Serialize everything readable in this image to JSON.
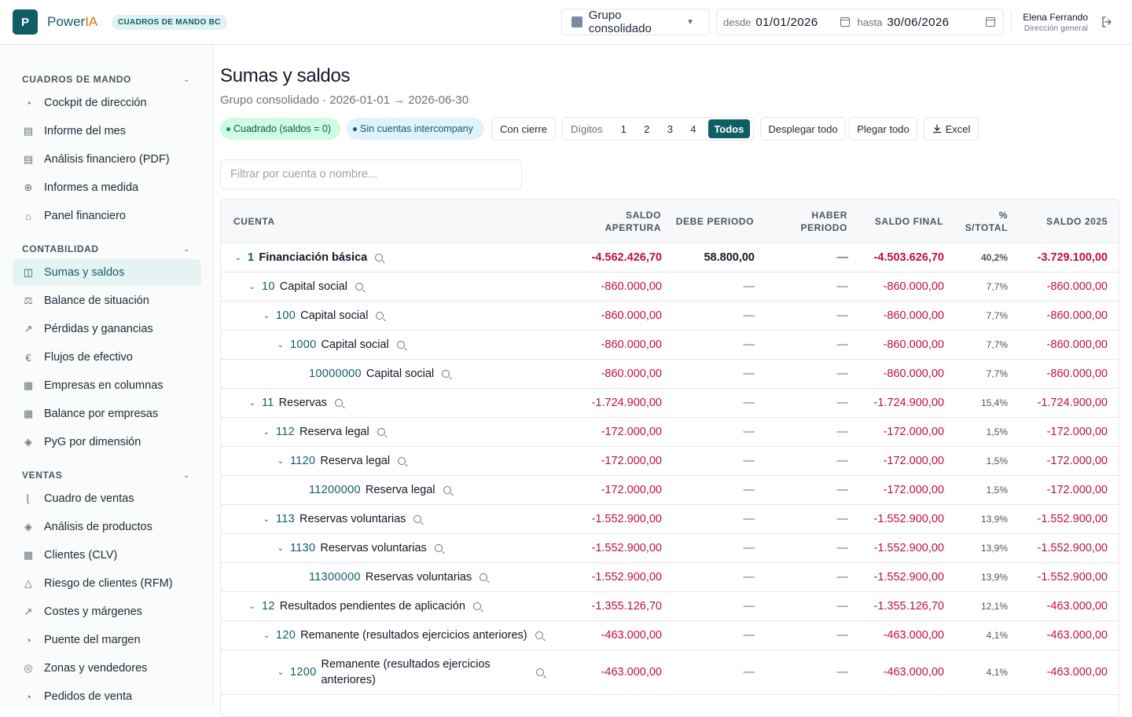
{
  "header": {
    "logo_letter": "P",
    "brand_main": "Power",
    "brand_accent": "IA",
    "module": "CUADROS DE MANDO BC",
    "group": "Grupo consolidado",
    "date_from_label": "desde",
    "date_from": "01/01/2026",
    "date_to_label": "hasta",
    "date_to": "30/06/2026",
    "user_name": "Elena Ferrando",
    "user_role": "Dirección general"
  },
  "sidebar": {
    "sections": [
      {
        "title": "CUADROS DE MANDO",
        "items": [
          {
            "label": "Cockpit de dirección",
            "icon": "gauge-icon"
          },
          {
            "label": "Informe del mes",
            "icon": "document-icon"
          },
          {
            "label": "Análisis financiero (PDF)",
            "icon": "document-icon"
          },
          {
            "label": "Informes a medida",
            "icon": "plus-circle-icon"
          },
          {
            "label": "Panel financiero",
            "icon": "home-icon"
          }
        ]
      },
      {
        "title": "CONTABILIDAD",
        "items": [
          {
            "label": "Sumas y saldos",
            "icon": "book-icon",
            "active": true
          },
          {
            "label": "Balance de situación",
            "icon": "scale-icon"
          },
          {
            "label": "Pérdidas y ganancias",
            "icon": "trend-icon"
          },
          {
            "label": "Flujos de efectivo",
            "icon": "euro-icon"
          },
          {
            "label": "Empresas en columnas",
            "icon": "building-icon"
          },
          {
            "label": "Balance por empresas",
            "icon": "building-icon"
          },
          {
            "label": "PyG por dimensión",
            "icon": "layers-icon"
          }
        ]
      },
      {
        "title": "VENTAS",
        "items": [
          {
            "label": "Cuadro de ventas",
            "icon": "chart-icon"
          },
          {
            "label": "Análisis de productos",
            "icon": "layers-icon"
          },
          {
            "label": "Clientes (CLV)",
            "icon": "building-icon"
          },
          {
            "label": "Riesgo de clientes (RFM)",
            "icon": "bell-icon"
          },
          {
            "label": "Costes y márgenes",
            "icon": "trend-icon"
          },
          {
            "label": "Puente del margen",
            "icon": "gauge-icon"
          },
          {
            "label": "Zonas y vendedores",
            "icon": "target-icon"
          },
          {
            "label": "Pedidos de venta",
            "icon": "gauge-icon"
          }
        ]
      }
    ]
  },
  "main": {
    "title": "Sumas y saldos",
    "subtitle": "Grupo consolidado · 2026-01-01 → 2026-06-30",
    "chip_balanced": "Cuadrado (saldos = 0)",
    "chip_intercompany": "Sin cuentas intercompany",
    "btn_closing": "Con cierre",
    "digits_label": "Dígitos",
    "digits": [
      "1",
      "2",
      "3",
      "4"
    ],
    "digits_active": "Todos",
    "btn_expand": "Desplegar todo",
    "btn_collapse": "Plegar todo",
    "btn_excel": "Excel",
    "filter_placeholder": "Filtrar por cuenta o nombre..."
  },
  "table": {
    "headers": {
      "account": "CUENTA",
      "opening_1": "SALDO",
      "opening_2": "APERTURA",
      "debit": "DEBE PERIODO",
      "credit_1": "HABER",
      "credit_2": "PERIODO",
      "final": "SALDO FINAL",
      "pct_1": "%",
      "pct_2": "S/TOTAL",
      "prev": "SALDO 2025"
    },
    "rows": [
      {
        "level": 0,
        "code": "1",
        "name": "Financiación básica",
        "expand": true,
        "opening": "-4.562.426,70",
        "debit": "58.800,00",
        "credit": "—",
        "final": "-4.503.626,70",
        "pct": "40,2%",
        "prev": "-3.729.100,00"
      },
      {
        "level": 1,
        "code": "10",
        "name": "Capital social",
        "expand": true,
        "opening": "-860.000,00",
        "debit": "—",
        "credit": "—",
        "final": "-860.000,00",
        "pct": "7,7%",
        "prev": "-860.000,00"
      },
      {
        "level": 2,
        "code": "100",
        "name": "Capital social",
        "expand": true,
        "opening": "-860.000,00",
        "debit": "—",
        "credit": "—",
        "final": "-860.000,00",
        "pct": "7,7%",
        "prev": "-860.000,00"
      },
      {
        "level": 3,
        "code": "1000",
        "name": "Capital social",
        "expand": true,
        "opening": "-860.000,00",
        "debit": "—",
        "credit": "—",
        "final": "-860.000,00",
        "pct": "7,7%",
        "prev": "-860.000,00"
      },
      {
        "level": 4,
        "code": "10000000",
        "name": "Capital social",
        "expand": false,
        "opening": "-860.000,00",
        "debit": "—",
        "credit": "—",
        "final": "-860.000,00",
        "pct": "7,7%",
        "prev": "-860.000,00"
      },
      {
        "level": 1,
        "code": "11",
        "name": "Reservas",
        "expand": true,
        "opening": "-1.724.900,00",
        "debit": "—",
        "credit": "—",
        "final": "-1.724.900,00",
        "pct": "15,4%",
        "prev": "-1.724.900,00"
      },
      {
        "level": 2,
        "code": "112",
        "name": "Reserva legal",
        "expand": true,
        "opening": "-172.000,00",
        "debit": "—",
        "credit": "—",
        "final": "-172.000,00",
        "pct": "1,5%",
        "prev": "-172.000,00"
      },
      {
        "level": 3,
        "code": "1120",
        "name": "Reserva legal",
        "expand": true,
        "opening": "-172.000,00",
        "debit": "—",
        "credit": "—",
        "final": "-172.000,00",
        "pct": "1,5%",
        "prev": "-172.000,00"
      },
      {
        "level": 4,
        "code": "11200000",
        "name": "Reserva legal",
        "expand": false,
        "opening": "-172.000,00",
        "debit": "—",
        "credit": "—",
        "final": "-172.000,00",
        "pct": "1,5%",
        "prev": "-172.000,00"
      },
      {
        "level": 2,
        "code": "113",
        "name": "Reservas voluntarias",
        "expand": true,
        "opening": "-1.552.900,00",
        "debit": "—",
        "credit": "—",
        "final": "-1.552.900,00",
        "pct": "13,9%",
        "prev": "-1.552.900,00"
      },
      {
        "level": 3,
        "code": "1130",
        "name": "Reservas voluntarias",
        "expand": true,
        "opening": "-1.552.900,00",
        "debit": "—",
        "credit": "—",
        "final": "-1.552.900,00",
        "pct": "13,9%",
        "prev": "-1.552.900,00"
      },
      {
        "level": 4,
        "code": "11300000",
        "name": "Reservas voluntarias",
        "expand": false,
        "opening": "-1.552.900,00",
        "debit": "—",
        "credit": "—",
        "final": "-1.552.900,00",
        "pct": "13,9%",
        "prev": "-1.552.900,00"
      },
      {
        "level": 1,
        "code": "12",
        "name": "Resultados pendientes de aplicación",
        "expand": true,
        "opening": "-1.355.126,70",
        "debit": "—",
        "credit": "—",
        "final": "-1.355.126,70",
        "pct": "12,1%",
        "prev": "-463.000,00"
      },
      {
        "level": 2,
        "code": "120",
        "name": "Remanente (resultados ejercicios anteriores)",
        "expand": true,
        "opening": "-463.000,00",
        "debit": "—",
        "credit": "—",
        "final": "-463.000,00",
        "pct": "4,1%",
        "prev": "-463.000,00"
      },
      {
        "level": 3,
        "code": "1200",
        "name_line1": "Remanente (resultados ejercicios",
        "name_line2": "anteriores)",
        "expand": true,
        "tall": true,
        "opening": "-463.000,00",
        "debit": "—",
        "credit": "—",
        "final": "-463.000,00",
        "pct": "4,1%",
        "prev": "-463.000,00"
      }
    ]
  },
  "colors": {
    "brand": "#0f5e66",
    "accent": "#d97706",
    "negative": "#be123c",
    "chip_green_bg": "#d1fae5",
    "chip_blue_bg": "#e0f2fe"
  }
}
